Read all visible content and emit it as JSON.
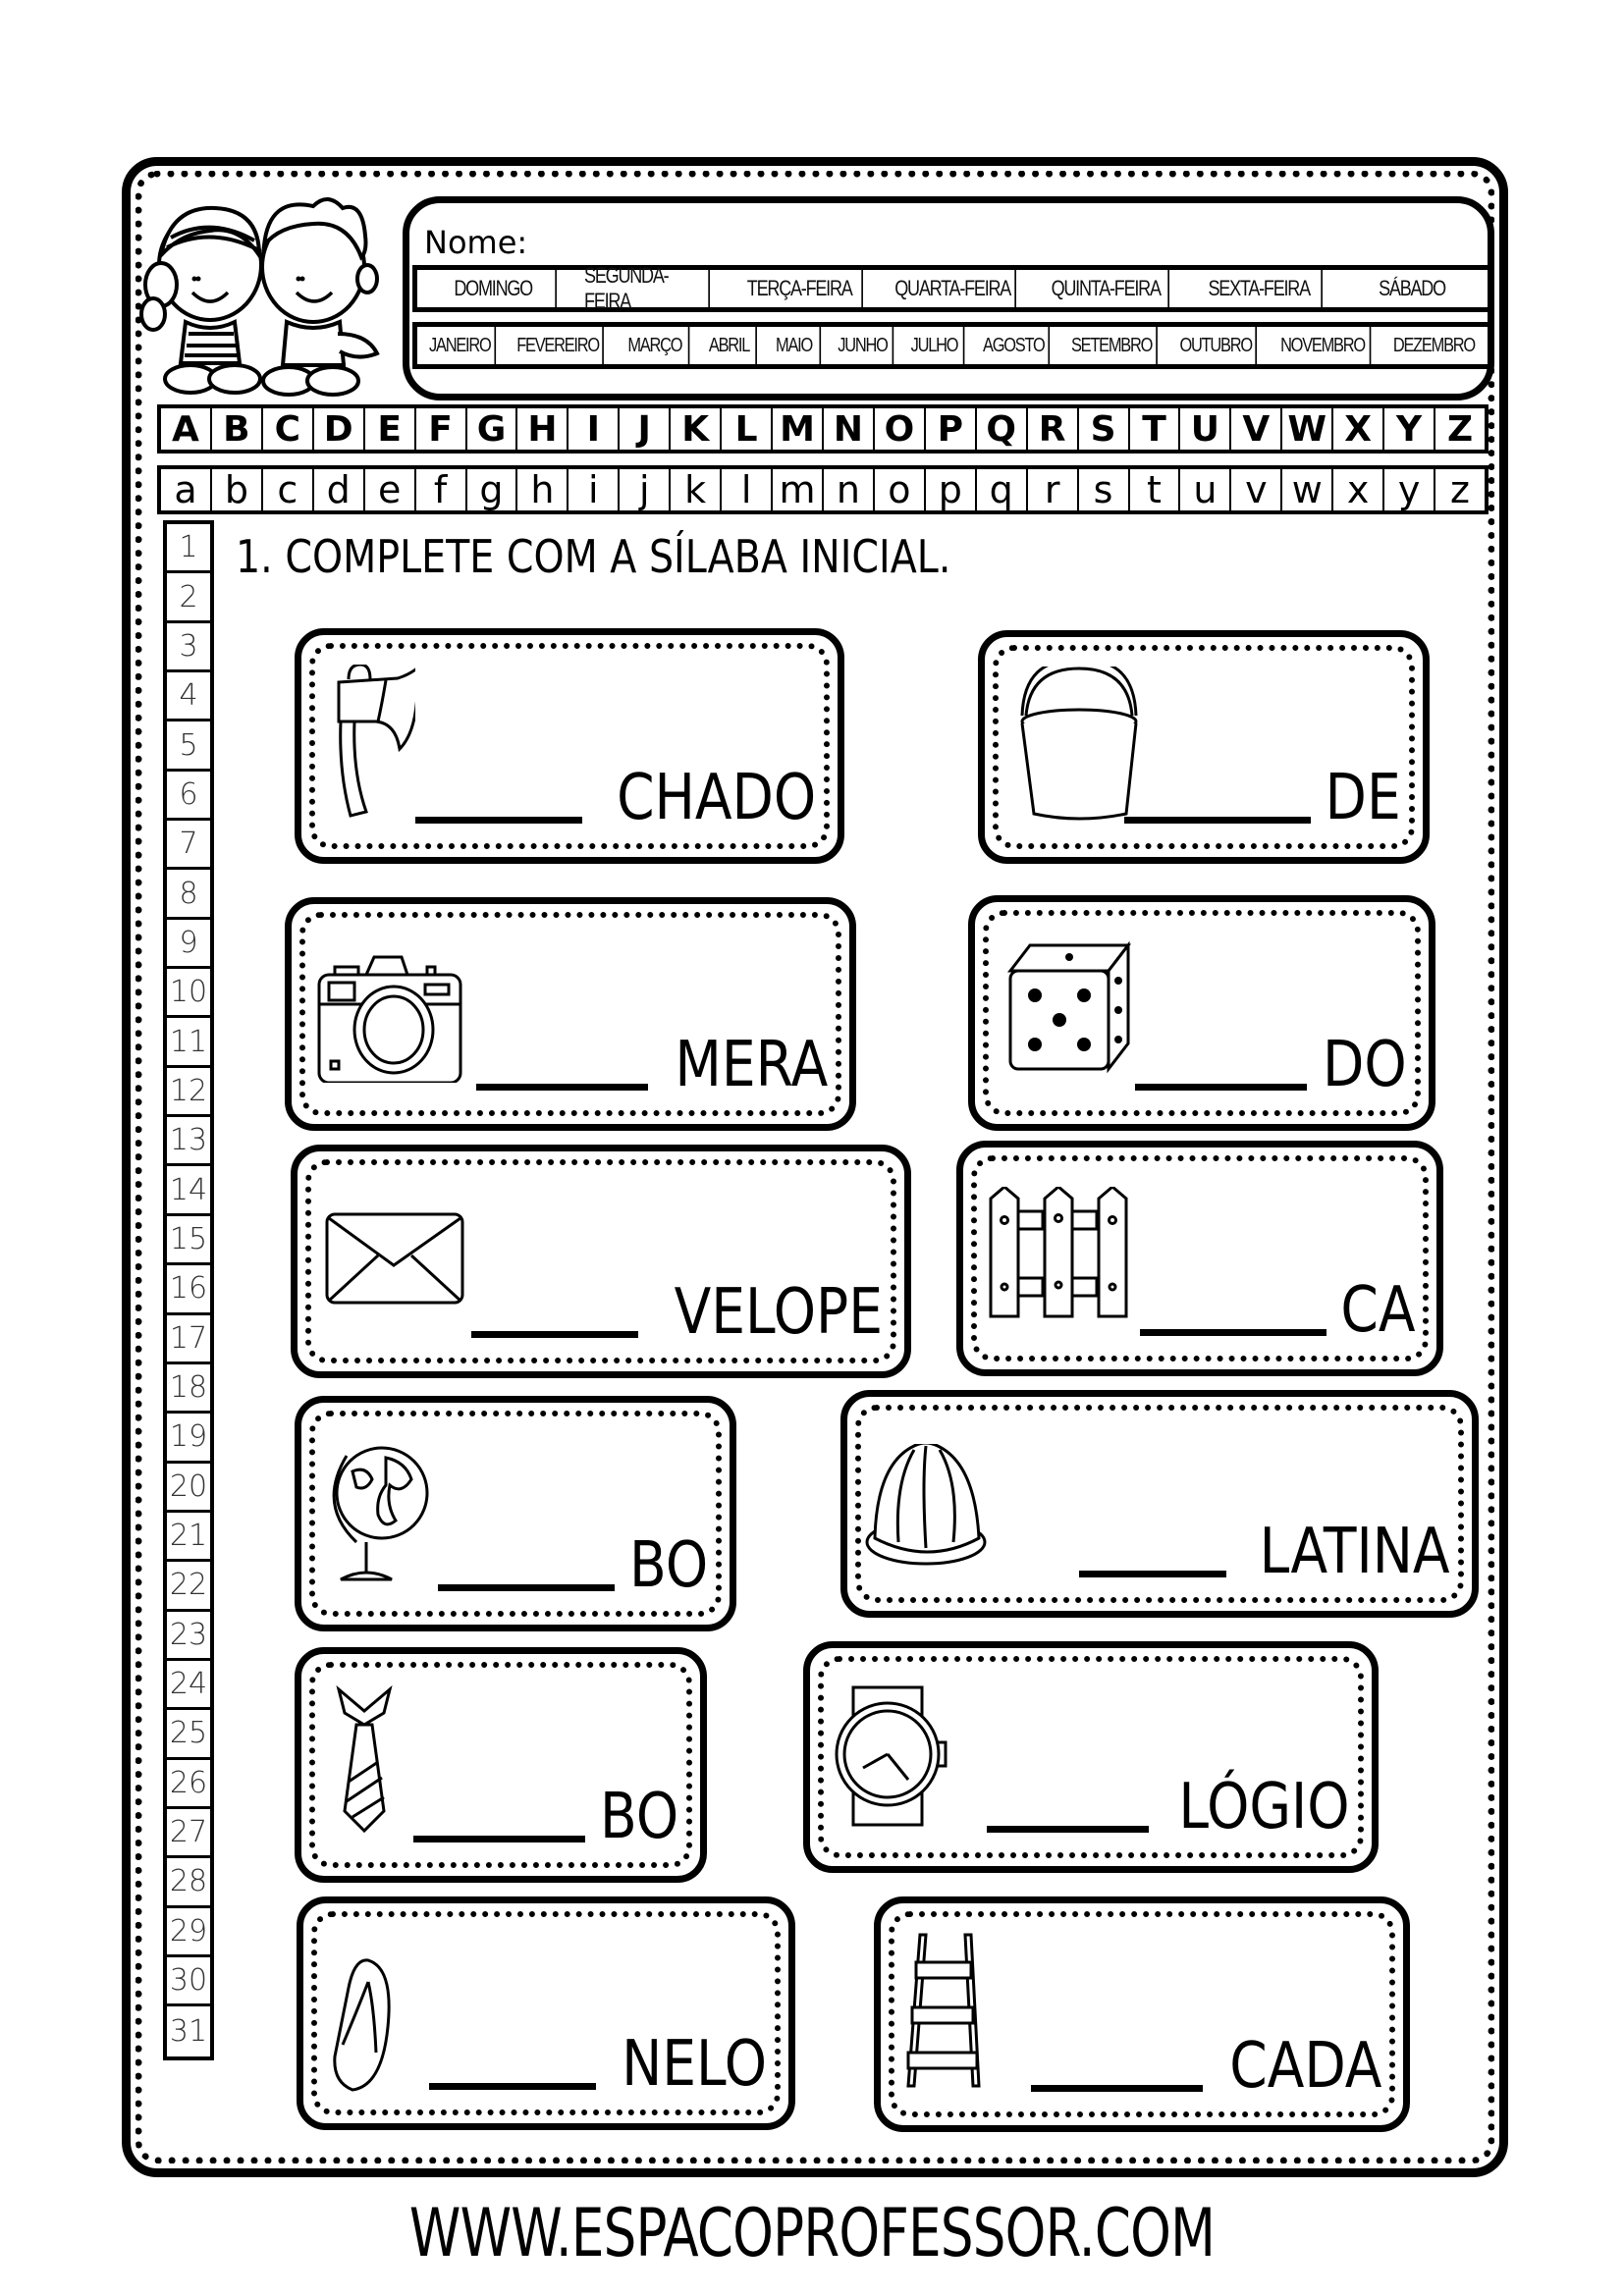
{
  "header": {
    "name_label": "Nome:",
    "days": [
      "DOMINGO",
      "SEGUNDA-FEIRA",
      "TERÇA-FEIRA",
      "QUARTA-FEIRA",
      "QUINTA-FEIRA",
      "SEXTA-FEIRA",
      "SÁBADO"
    ],
    "months": [
      "JANEIRO",
      "FEVEREIRO",
      "MARÇO",
      "ABRIL",
      "MAIO",
      "JUNHO",
      "JULHO",
      "AGOSTO",
      "SETEMBRO",
      "OUTUBRO",
      "NOVEMBRO",
      "DEZEMBRO"
    ]
  },
  "alphabet": {
    "upper": [
      "A",
      "B",
      "C",
      "D",
      "E",
      "F",
      "G",
      "H",
      "I",
      "J",
      "K",
      "L",
      "M",
      "N",
      "O",
      "P",
      "Q",
      "R",
      "S",
      "T",
      "U",
      "V",
      "W",
      "X",
      "Y",
      "Z"
    ],
    "lower": [
      "a",
      "b",
      "c",
      "d",
      "e",
      "f",
      "g",
      "h",
      "i",
      "j",
      "k",
      "l",
      "m",
      "n",
      "o",
      "p",
      "q",
      "r",
      "s",
      "t",
      "u",
      "v",
      "w",
      "x",
      "y",
      "z"
    ]
  },
  "day_numbers": [
    "1",
    "2",
    "3",
    "4",
    "5",
    "6",
    "7",
    "8",
    "9",
    "10",
    "11",
    "12",
    "13",
    "14",
    "15",
    "16",
    "17",
    "18",
    "19",
    "20",
    "21",
    "22",
    "23",
    "24",
    "25",
    "26",
    "27",
    "28",
    "29",
    "30",
    "31"
  ],
  "exercise": {
    "instruction": "1. COMPLETE COM A SÍLABA INICIAL.",
    "cards": [
      {
        "icon": "axe-icon",
        "ending": "CHADO"
      },
      {
        "icon": "bucket-icon",
        "ending": "DE"
      },
      {
        "icon": "camera-icon",
        "ending": "MERA"
      },
      {
        "icon": "dice-icon",
        "ending": "DO"
      },
      {
        "icon": "envelope-icon",
        "ending": "VELOPE"
      },
      {
        "icon": "fence-icon",
        "ending": "CA"
      },
      {
        "icon": "globe-icon",
        "ending": "BO"
      },
      {
        "icon": "gelatin-icon",
        "ending": "LATINA"
      },
      {
        "icon": "tie-icon",
        "ending": "BO"
      },
      {
        "icon": "watch-icon",
        "ending": "LÓGIO"
      },
      {
        "icon": "flip-flop-icon",
        "ending": "NELO"
      },
      {
        "icon": "ladder-icon",
        "ending": "CADA"
      }
    ]
  },
  "footer": {
    "website": "WWW.ESPACOPROFESSOR.COM"
  }
}
